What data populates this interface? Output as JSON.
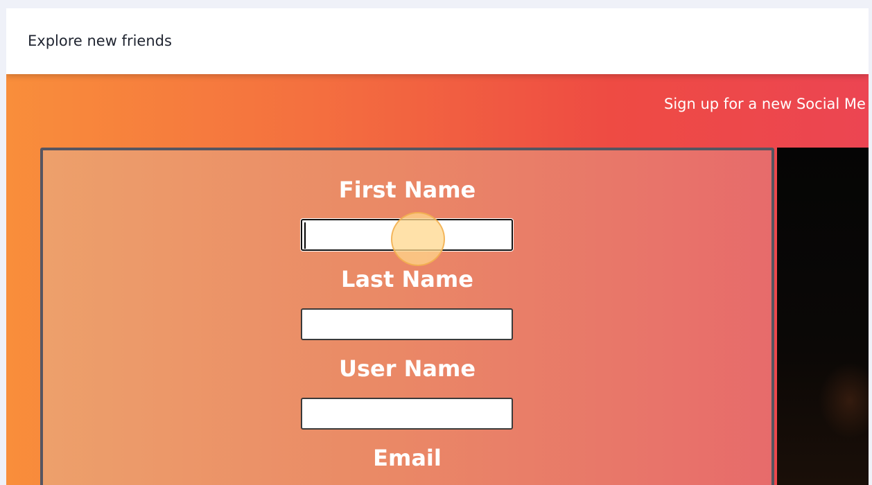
{
  "header": {
    "title": "Explore new friends"
  },
  "hero": {
    "heading": "",
    "subtitle": "Sign up for a new Social Me"
  },
  "form": {
    "fields": [
      {
        "label": "First Name",
        "value": "",
        "focused": true
      },
      {
        "label": "Last Name",
        "value": ""
      },
      {
        "label": "User Name",
        "value": ""
      },
      {
        "label": "Email",
        "value": ""
      }
    ]
  },
  "colors": {
    "page_background": "#eff1f8",
    "gradient_start": "#f98e3b",
    "gradient_end": "#ec4552",
    "card_border": "#565560",
    "click_marker": "#ffd78c"
  }
}
